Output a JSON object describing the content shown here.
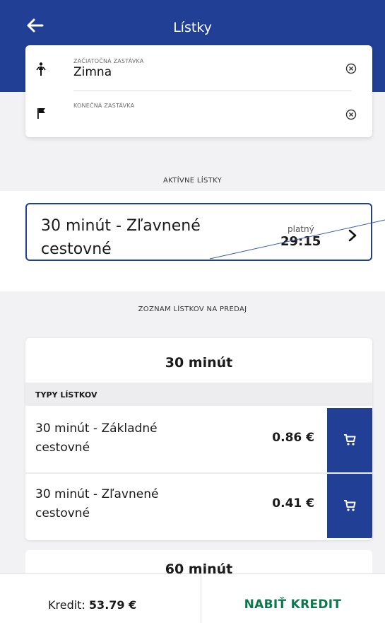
{
  "header": {
    "title": "Lístky",
    "back_icon": "arrow-left-icon"
  },
  "stops": {
    "start": {
      "label": "ZAČIATOČNÁ ZASTÁVKA",
      "value": "Zimna",
      "icon": "person-walking-icon",
      "clear_icon": "clear-circle-icon"
    },
    "end": {
      "label": "KONEČNÁ ZASTÁVKA",
      "value": "",
      "icon": "flag-icon",
      "clear_icon": "clear-circle-icon"
    }
  },
  "active": {
    "section_label": "AKTÍVNE LÍSTKY",
    "ticket_name": "30 minút - Zľavnené cestovné",
    "valid_label": "platný",
    "valid_time": "29:15"
  },
  "sale": {
    "section_label": "ZOZNAM LÍSTKOV NA PREDAJ",
    "groups": [
      {
        "title": "30 minút",
        "types_label": "TYPY LÍSTKOV",
        "tickets": [
          {
            "name": "30 minút - Základné cestovné",
            "price": "0.86 €"
          },
          {
            "name": "30 minút - Zľavnené cestovné",
            "price": "0.41 €"
          }
        ]
      },
      {
        "title": "60 minút"
      }
    ]
  },
  "footer": {
    "credit_label": "Kredit:",
    "credit_value": "53.79 €",
    "topup_label": "NABIŤ KREDIT"
  },
  "colors": {
    "brand": "#213f95",
    "accent_green": "#0b7a4a",
    "background": "#f2f2f4"
  }
}
